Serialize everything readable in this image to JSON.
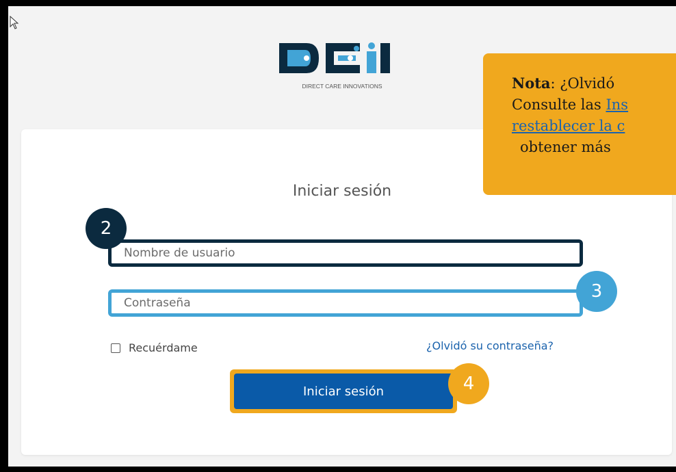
{
  "logo": {
    "wordmark": "DCI",
    "tagline": "DIRECT CARE INNOVATIONS",
    "colors": {
      "dark": "#0b2a3f",
      "light": "#42a4d6"
    }
  },
  "login": {
    "title": "Iniciar sesión",
    "username_placeholder": "Nombre de usuario",
    "password_placeholder": "Contraseña",
    "remember_label": "Recuérdame",
    "forgot_link": "¿Olvidó su contraseña?",
    "submit_label": "Iniciar sesión"
  },
  "callouts": {
    "step2": "2",
    "step3": "3",
    "step4": "4"
  },
  "note": {
    "label": "Nota",
    "line1_rest": ": ¿Olvidó",
    "line2_prefix": "Consulte las ",
    "line2_link": "Ins",
    "line3_link": "restablecer la c",
    "line4": "obtener más"
  },
  "colors": {
    "accent_orange": "#f0a81e",
    "primary_blue": "#0a5aa8",
    "link_blue": "#1b63ad"
  }
}
